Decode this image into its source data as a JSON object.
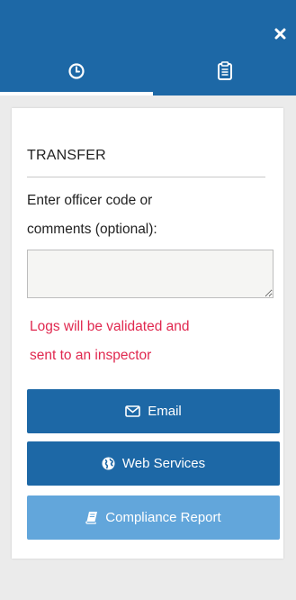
{
  "header": {
    "close_icon": "close-icon",
    "tabs": [
      {
        "icon": "clock-icon",
        "active": true
      },
      {
        "icon": "clipboard-icon",
        "active": false
      }
    ]
  },
  "transfer": {
    "title": "TRANSFER",
    "instruction_line1": "Enter officer code or",
    "instruction_line2": "comments (optional):",
    "comment_value": "",
    "warning_line1": "Logs will be validated and",
    "warning_line2": "sent to an inspector"
  },
  "buttons": {
    "email_label": "Email",
    "web_services_label": "Web Services",
    "compliance_label": "Compliance Report"
  },
  "colors": {
    "primary": "#1d68a6",
    "disabled": "#62a6db",
    "warning": "#e0284f"
  }
}
